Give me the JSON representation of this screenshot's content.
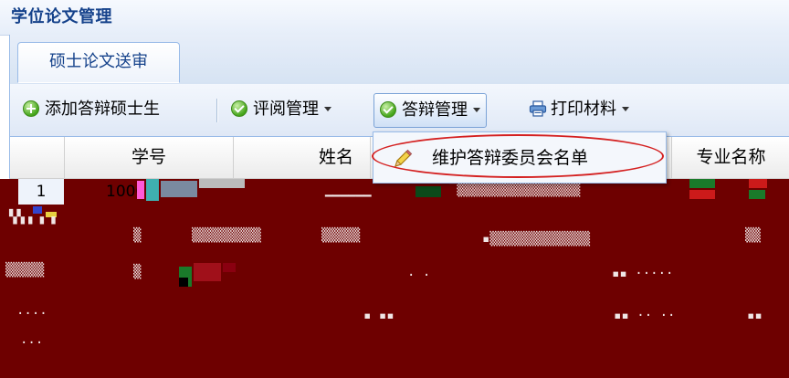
{
  "window": {
    "title": "学位论文管理"
  },
  "tabs": [
    {
      "label": "硕士论文送审",
      "active": true
    }
  ],
  "toolbar": {
    "add_label": "添加答辩硕士生",
    "review_label": "评阅管理",
    "defense_label": "答辩管理",
    "print_label": "打印材料"
  },
  "grid": {
    "columns": [
      "学号",
      "姓名",
      "专业名称"
    ],
    "rows": [
      {
        "index": "1",
        "student_id": "1000"
      }
    ]
  },
  "menu": {
    "items": [
      {
        "label": "维护答辩委员会名单",
        "icon": "pencil-icon"
      }
    ]
  },
  "colors": {
    "title_text": "#15428b",
    "panel_border": "#99bbe8",
    "highlight_ellipse": "#d42020",
    "corrupted_area": "#6e0000"
  }
}
